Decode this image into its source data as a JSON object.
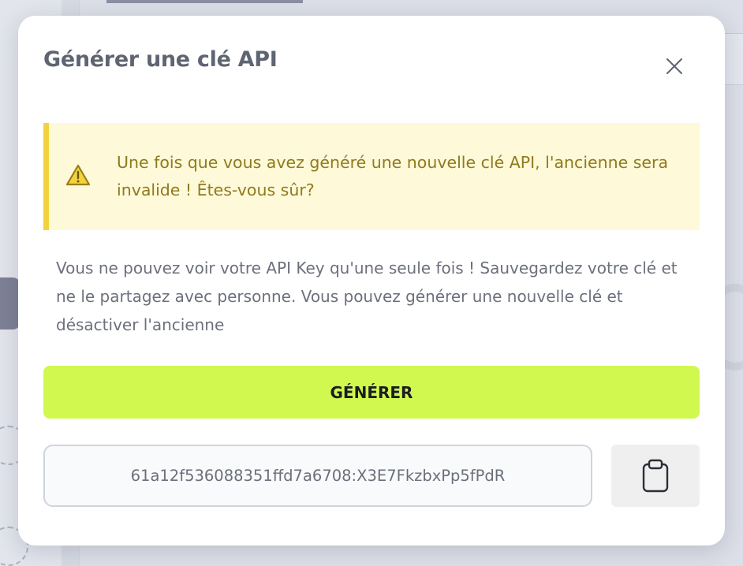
{
  "dialog": {
    "title": "Générer une clé API",
    "close_icon": "close-icon",
    "warning": {
      "icon": "warning-triangle-icon",
      "text": "Une fois que vous avez généré une nouvelle clé API, l'ancienne sera invalide ! Êtes-vous sûr?",
      "accent_color": "#f4d23d",
      "background_color": "#fef9d8"
    },
    "info_text": "Vous ne pouvez voir votre API Key qu'une seule fois ! Sauvegardez votre clé et ne le partagez avec personne. Vous pouvez générer une nouvelle clé et désactiver l'ancienne",
    "generate_button": {
      "label": "GÉNÉRER",
      "color": "#d1f84f"
    },
    "api_key": {
      "value": "61a12f536088351ffd7a6708:X3E7FkzbxPp5fPdR"
    },
    "copy_button": {
      "icon": "clipboard-icon"
    }
  }
}
